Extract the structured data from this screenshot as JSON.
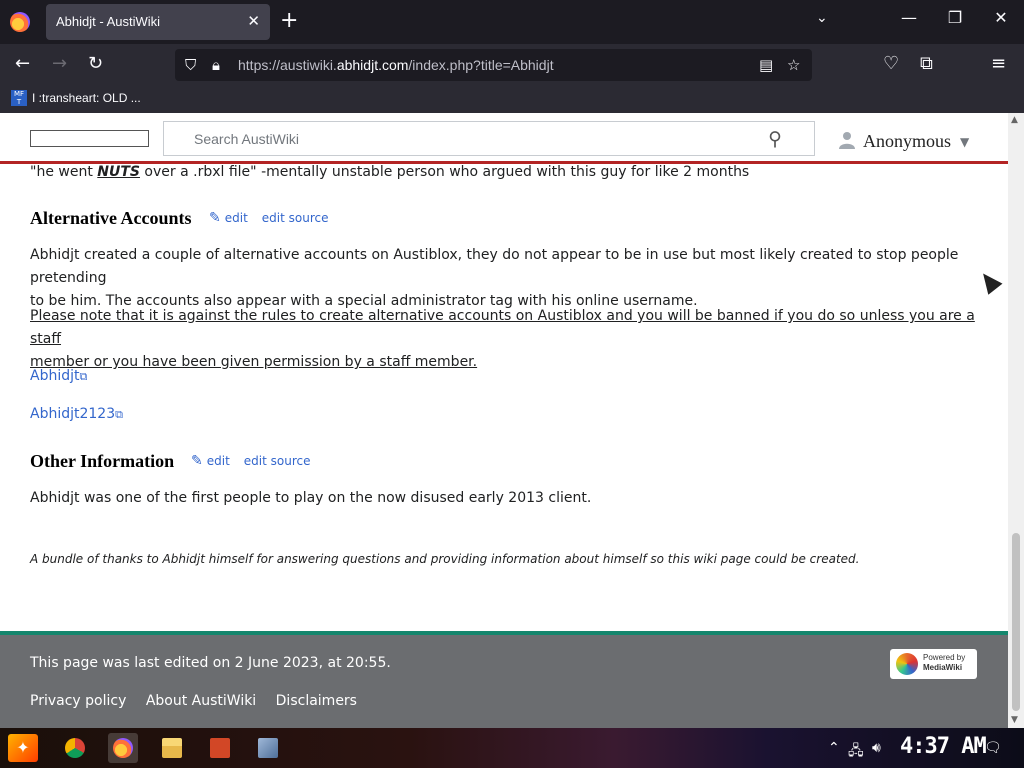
{
  "browser": {
    "tab_title": "Abhidjt - AustiWiki",
    "tab_close": "✕",
    "new_tab": "+",
    "url_prefix": "https://austiwiki.",
    "url_domain": "abhidjt.com",
    "url_suffix": "/index.php?title=Abhidjt",
    "bookmark_label": "I :transheart: OLD ...",
    "bookmark_icon_text": "MF T"
  },
  "wiki": {
    "search_placeholder": "Search AustiWiki",
    "user_name": "Anonymous",
    "quote_prefix": "\"he went ",
    "quote_emph": "NUTS",
    "quote_suffix": " over a .rbxl file\" -mentally unstable person who argued with this guy for like 2 months",
    "sections": [
      {
        "heading": "Alternative Accounts",
        "edit": "edit",
        "edit_source": "edit source"
      },
      {
        "heading": "Other Information",
        "edit": "edit",
        "edit_source": "edit source"
      }
    ],
    "alt_para1_line1": "Abhidjt created a couple of alternative accounts on Austiblox, they do not appear to be in use but most likely created to stop people pretending",
    "alt_para1_line2": "to be him. The accounts also appear with a special administrator tag with his online username.",
    "alt_para2_line1": "Please note that it is against the rules to create alternative accounts on Austiblox and you will be banned if you do so unless you are a staff",
    "alt_para2_line2": "member or you have been given permission by a staff member.",
    "account_links": [
      "Abhidjt",
      "Abhidjt2123"
    ],
    "other_para": "Abhidjt was one of the first people to play on the now disused early 2013 client.",
    "thanks": "A bundle of thanks to Abhidjt himself for answering questions and providing information about himself so this wiki page could be created.",
    "footer": {
      "last_edited": "This page was last edited on 2 June 2023, at 20:55.",
      "links": [
        "Privacy policy",
        "About AustiWiki",
        "Disclaimers"
      ],
      "powered_line1": "Powered by",
      "powered_line2": "MediaWiki"
    }
  },
  "taskbar": {
    "clock": "4:37 AM"
  },
  "colors": {
    "link": "#3366cc",
    "header_rule": "#b32424",
    "footer_bg": "#6b6d70",
    "footer_rule": "#14866d"
  }
}
